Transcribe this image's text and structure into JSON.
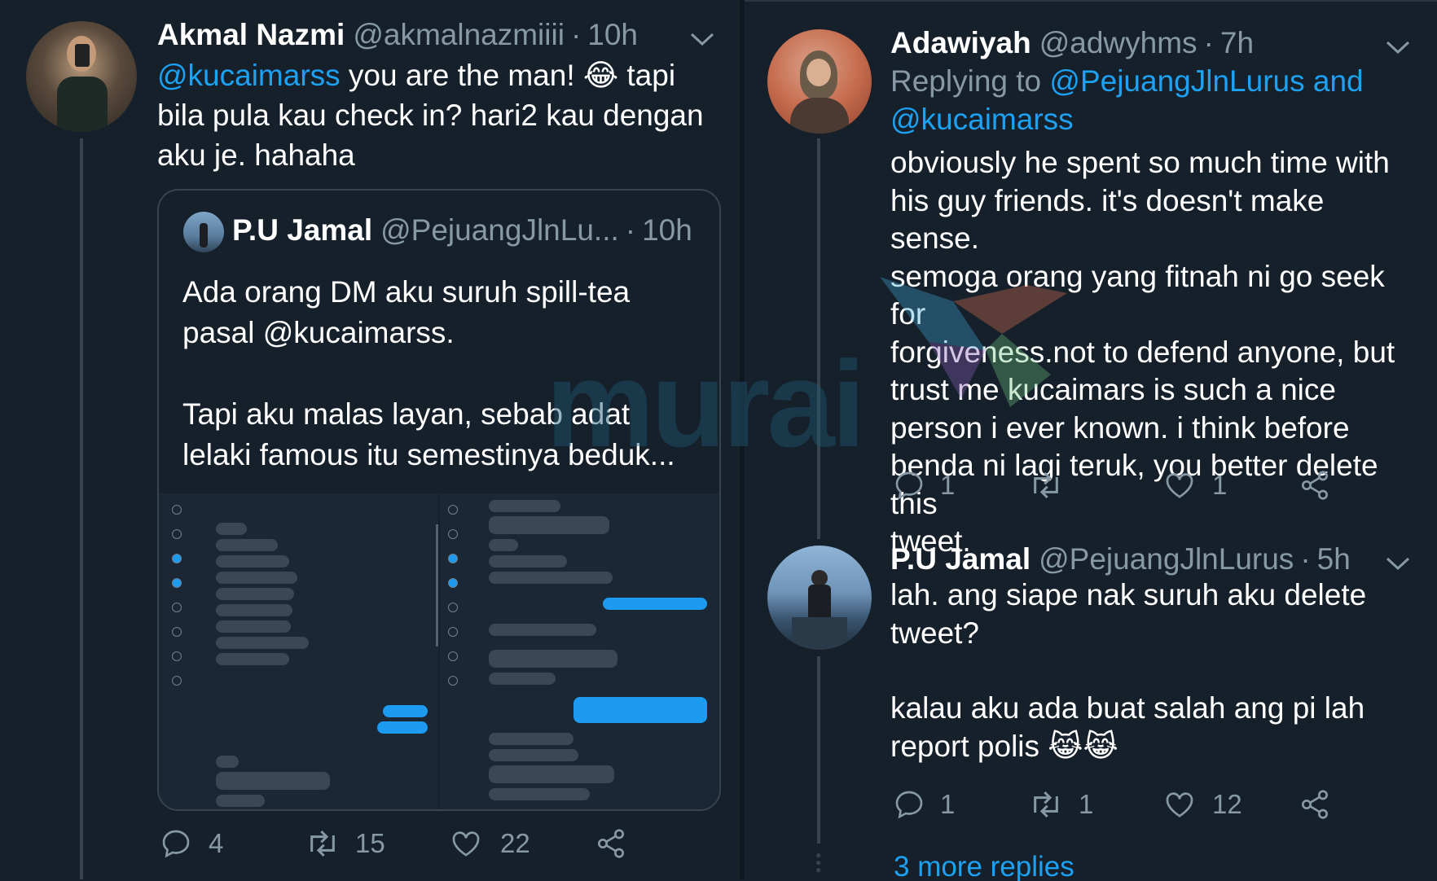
{
  "left_tweet": {
    "author_name": "Akmal Nazmi",
    "author_handle": "@akmalnazmiiii",
    "separator": "·",
    "time": "10h",
    "mention": "@kucaimarss",
    "text_part1": " you are the man! 😂 tapi",
    "text_line2": "bila pula kau check in? hari2 kau dengan",
    "text_line3": "aku je. hahaha",
    "quoted": {
      "author_name": "P.U Jamal",
      "author_handle": "@PejuangJlnLu...",
      "time": "10h",
      "line1": "Ada orang DM aku suruh spill-tea",
      "line2": "pasal @kucaimarss.",
      "line3": "Tapi aku malas layan, sebab adat",
      "line4": "lelaki famous itu semestinya beduk..."
    },
    "actions": {
      "replies": "4",
      "retweets": "15",
      "likes": "22"
    }
  },
  "right_tweet_1": {
    "author_name": "Adawiyah",
    "author_handle": "@adwyhms",
    "separator": "·",
    "time": "7h",
    "replying_label": "Replying to",
    "replying_to_1": "@PejuangJlnLurus and",
    "replying_to_2": "@kucaimarss",
    "lines": [
      "obviously he spent so much time with",
      "his guy friends. it's doesn't make sense.",
      "semoga orang yang fitnah ni go seek for",
      "forgiveness.not to defend anyone, but",
      "trust me kucaimars is such a nice",
      "person i ever known. i think before",
      "benda ni lagi teruk, you better delete this",
      "tweet."
    ],
    "actions": {
      "replies": "1",
      "retweets": "",
      "likes": "1"
    }
  },
  "right_tweet_2": {
    "author_name": "P.U Jamal",
    "author_handle": "@PejuangJlnLurus",
    "separator": "·",
    "time": "5h",
    "line1": "lah. ang siape nak suruh aku delete",
    "line2": "tweet?",
    "line3": "kalau aku ada buat salah ang pi lah",
    "line4": "report polis 😹😹",
    "actions": {
      "replies": "1",
      "retweets": "1",
      "likes": "12"
    }
  },
  "more_replies": "3 more replies",
  "watermark": "murai",
  "colors": {
    "bg": "#15202b",
    "accent": "#1da1f2",
    "muted": "#8899a6",
    "border": "#38444d"
  },
  "icons": [
    "chevron-down-icon",
    "reply-icon",
    "retweet-icon",
    "like-icon",
    "share-icon"
  ]
}
